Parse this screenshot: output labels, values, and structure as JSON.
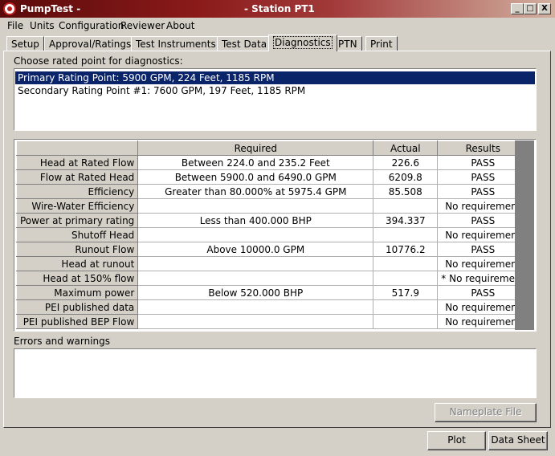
{
  "window": {
    "app_name": "PumpTest -",
    "station": "- Station PT1",
    "minimize": "_",
    "maximize": "□",
    "close": "X"
  },
  "menu": [
    "File",
    "Units",
    "Configuration",
    "Reviewer",
    "About"
  ],
  "tabs": [
    "Setup",
    "Approval/Ratings",
    "Test Instruments",
    "Test Data",
    "Diagnostics",
    "PTN",
    "Print"
  ],
  "active_tab": "Diagnostics",
  "choose_label": "Choose rated point for diagnostics:",
  "rating_points": [
    "Primary Rating Point: 5900 GPM, 224 Feet, 1185 RPM",
    "Secondary Rating Point #1: 7600 GPM, 197 Feet, 1185 RPM"
  ],
  "table": {
    "headers": [
      "",
      "Required",
      "Actual",
      "Results"
    ],
    "rows": [
      [
        "Head at Rated Flow",
        "Between 224.0 and 235.2 Feet",
        "226.6",
        "PASS"
      ],
      [
        "Flow at Rated Head",
        "Between 5900.0 and 6490.0 GPM",
        "6209.8",
        "PASS"
      ],
      [
        "Efficiency",
        "Greater than 80.000% at 5975.4 GPM",
        "85.508",
        "PASS"
      ],
      [
        "Wire-Water Efficiency",
        "",
        "",
        "No requirement"
      ],
      [
        "Power at primary rating",
        "Less than 400.000 BHP",
        "394.337",
        "PASS"
      ],
      [
        "Shutoff Head",
        "",
        "",
        "No requirement"
      ],
      [
        "Runout Flow",
        "Above 10000.0 GPM",
        "10776.2",
        "PASS"
      ],
      [
        "Head at runout",
        "",
        "",
        "No requirement"
      ],
      [
        "Head at 150% flow",
        "",
        "",
        "* No requirement"
      ],
      [
        "Maximum power",
        "Below 520.000 BHP",
        "517.9",
        "PASS"
      ],
      [
        "PEI published data",
        "",
        "",
        "No requirement"
      ],
      [
        "PEI published BEP Flow",
        "",
        "",
        "No requirement"
      ]
    ]
  },
  "errors_label": "Errors and warnings",
  "buttons": {
    "nameplate": "Nameplate File",
    "plot": "Plot",
    "datasheet": "Data Sheet"
  },
  "colors": {
    "selection": "#0a246a",
    "title_gradient_start": "#5a0a0a",
    "face": "#d4d0c8"
  }
}
